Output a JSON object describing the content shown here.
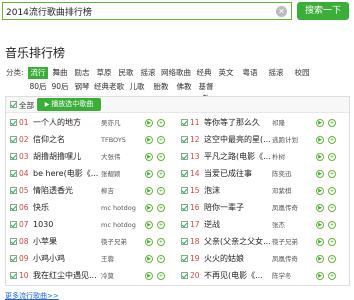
{
  "search": {
    "query": "2014流行歌曲排行榜",
    "button": "搜索一下"
  },
  "section": {
    "title": "音乐排行榜"
  },
  "category": {
    "label": "分类:",
    "items": [
      "流行",
      "舞曲",
      "励志",
      "草原",
      "民歌",
      "摇滚",
      "网络歌曲",
      "经典",
      "英文",
      "粤语",
      "摇滚",
      "校园",
      "80后",
      "90后",
      "钢琴",
      "经典老歌",
      "儿歌",
      "胎教",
      "佛教",
      "基督教"
    ],
    "active_index": 0
  },
  "toolbar": {
    "select_all": "全部",
    "play_selected": "播放选中歌曲"
  },
  "songs_left": [
    {
      "rank": "01",
      "title": "一个人的地方",
      "artist": "吴亦凡"
    },
    {
      "rank": "02",
      "title": "信仰之名",
      "artist": "TFBOYS"
    },
    {
      "rank": "03",
      "title": "胡撸胡撸嘿儿",
      "artist": "大张伟"
    },
    {
      "rank": "04",
      "title": "be here(电影《...",
      "artist": "张靓颖"
    },
    {
      "rank": "05",
      "title": "情陷透香光",
      "artist": "柳吉"
    },
    {
      "rank": "06",
      "title": "快乐",
      "artist": "mc hotdog"
    },
    {
      "rank": "07",
      "title": "1030",
      "artist": "mc hotdog"
    },
    {
      "rank": "08",
      "title": "小苹果",
      "artist": "筷子兄弟"
    },
    {
      "rank": "09",
      "title": "小鸡小鸡",
      "artist": "王蓉"
    },
    {
      "rank": "10",
      "title": "我在红尘中遇见...",
      "artist": "冷莫"
    }
  ],
  "songs_right": [
    {
      "rank": "11",
      "title": "等你等了那么久",
      "artist": "祁隆"
    },
    {
      "rank": "12",
      "title": "这空中最亮的星(...",
      "artist": "逃跑计划"
    },
    {
      "rank": "13",
      "title": "平凡之路(电影《...",
      "artist": "朴树"
    },
    {
      "rank": "14",
      "title": "当爱已成往事",
      "artist": "陈奕迅"
    },
    {
      "rank": "15",
      "title": "泡沫",
      "artist": "邓紫棋"
    },
    {
      "rank": "16",
      "title": "陪你一辈子",
      "artist": "凤凰传奇"
    },
    {
      "rank": "17",
      "title": "逆战",
      "artist": "张杰"
    },
    {
      "rank": "18",
      "title": "父亲(父亲之父女...",
      "artist": "筷子兄弟"
    },
    {
      "rank": "19",
      "title": "火火的姑娘",
      "artist": "凤凰传奇"
    },
    {
      "rank": "20",
      "title": "不再见(电影《...",
      "artist": "陈学冬"
    }
  ],
  "footer": {
    "more": "更多流行歌曲>>"
  }
}
